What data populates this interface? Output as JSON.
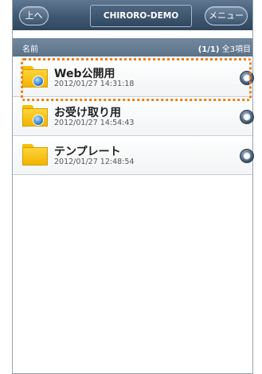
{
  "header": {
    "up_label": "上へ",
    "title": "CHIRORO-DEMO",
    "menu_label": "メニュー"
  },
  "list": {
    "column_label": "名前",
    "page_indicator": "(1/1)",
    "count_label": "全3項目",
    "items": [
      {
        "name": "Web公開用",
        "timestamp": "2012/01/27 14:31:18",
        "icon": "folder-globe-icon",
        "highlighted": true
      },
      {
        "name": "お受け取り用",
        "timestamp": "2012/01/27 14:54:43",
        "icon": "folder-globe-icon",
        "highlighted": false
      },
      {
        "name": "テンプレート",
        "timestamp": "2012/01/27 12:48:54",
        "icon": "folder-icon",
        "highlighted": false
      }
    ]
  },
  "colors": {
    "highlight": "#f07c14",
    "header_bg": "#3f5871",
    "folder": "#ffd43a"
  }
}
